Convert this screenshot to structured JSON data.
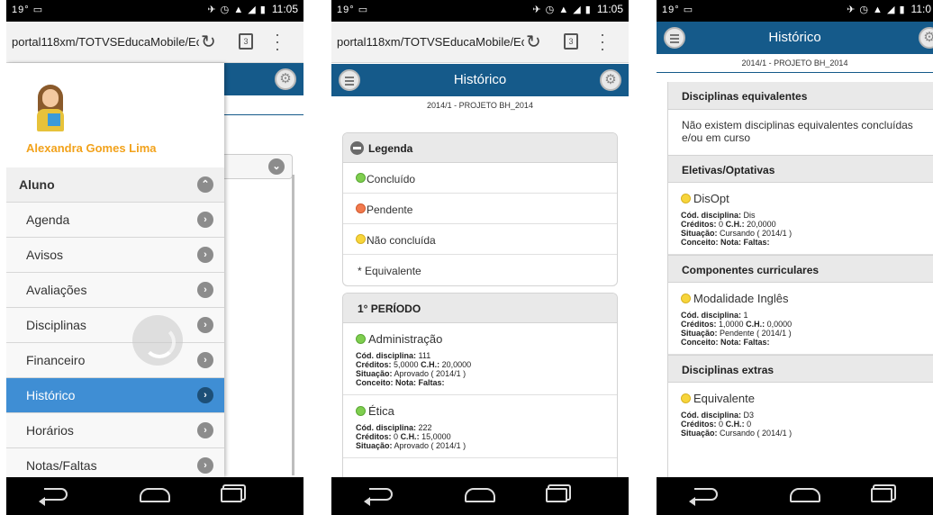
{
  "status_bar": {
    "left": "19° ▭",
    "left_short": "19°",
    "time": "11:05",
    "time_cut": "11:0"
  },
  "browser": {
    "url": "portal118xm/TOTVSEducaMobile/Ec",
    "tab_count": "3"
  },
  "app": {
    "title": "Histórico",
    "period_label": "2014/1 - PROJETO BH_2014"
  },
  "drawer": {
    "user_name": "Alexandra Gomes Lima",
    "section": "Aluno",
    "items": [
      "Agenda",
      "Avisos",
      "Avaliações",
      "Disciplinas",
      "Financeiro",
      "Histórico",
      "Horários",
      "Notas/Faltas"
    ],
    "active_item": "Histórico"
  },
  "legend": {
    "title": "Legenda",
    "items": [
      {
        "label": "Concluído",
        "color": "#7fce4f"
      },
      {
        "label": "Pendente",
        "color": "#f27a4e"
      },
      {
        "label": "Não concluída",
        "color": "#f7d53b"
      },
      {
        "label": "* Equivalente"
      }
    ]
  },
  "period1": {
    "title": "1° PERÍODO",
    "disciplines": [
      {
        "name": "Administração",
        "code": "111",
        "credits": "5,0000",
        "hours": "20,0000",
        "status": "Aprovado  ( 2014/1 )"
      },
      {
        "name": "Ética",
        "code": "222",
        "credits": "0",
        "hours": "15,0000",
        "status": "Aprovado  ( 2014/1 )"
      }
    ]
  },
  "labels": {
    "code": "Cód. disciplina:",
    "credits": "Créditos:",
    "hours": "C.H.:",
    "status": "Situação:",
    "grade_line": "Conceito:  Nota:  Faltas:"
  },
  "phone3": {
    "equivalents": {
      "title": "Disciplinas equivalentes",
      "text": "Não existem disciplinas equivalentes concluídas e/ou em curso"
    },
    "electives": {
      "title": "Eletivas/Optativas",
      "discipline": {
        "name": "DisOpt",
        "code": "Dis",
        "credits": "0",
        "hours": "20,0000",
        "status": "Cursando  ( 2014/1 )"
      }
    },
    "components": {
      "title": "Componentes curriculares",
      "discipline": {
        "name": "Modalidade Inglês",
        "code": "1",
        "credits": "1,0000",
        "hours": "0,0000",
        "status": "Pendente  ( 2014/1 )"
      }
    },
    "extras": {
      "title": "Disciplinas extras",
      "discipline": {
        "name": "Equivalente",
        "code": "D3",
        "credits": "0",
        "hours": "0",
        "status": "Cursando  ( 2014/1 )"
      }
    }
  },
  "icons": {
    "menu": "menu-icon",
    "settings": "gear-icon",
    "reload": "reload-icon",
    "tabs": "tabs-icon",
    "overflow": "more-vert-icon",
    "chevron": "chevron-right-icon",
    "collapse": "chevron-up-icon",
    "expand": "chevron-down-icon"
  }
}
